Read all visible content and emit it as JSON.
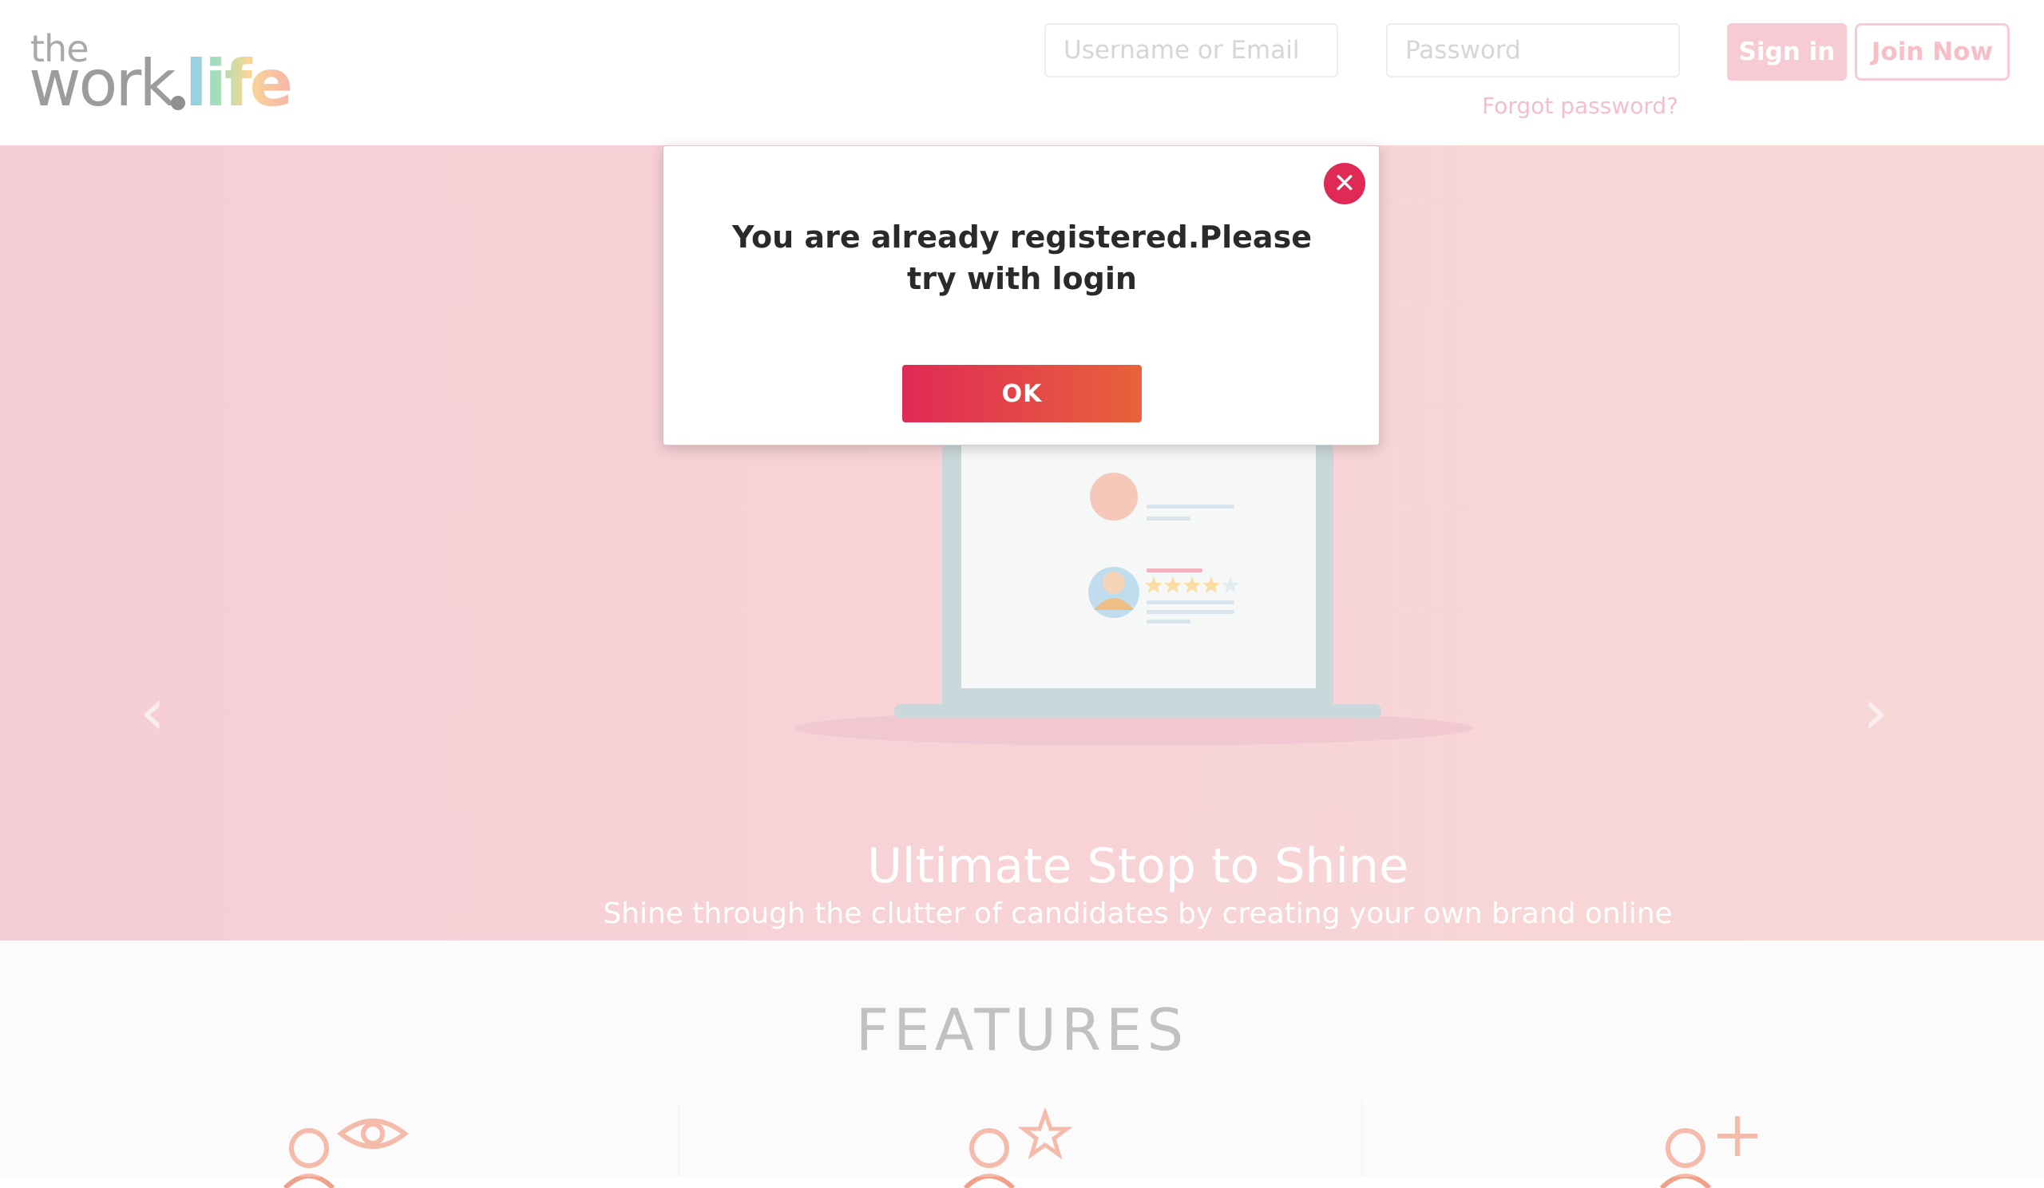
{
  "header": {
    "logo_top": "the",
    "logo_left": "work",
    "logo_right": "life",
    "username_placeholder": "Username or Email",
    "password_placeholder": "Password",
    "forgot_label": "Forgot password?",
    "signin_label": "Sign in",
    "join_label": "Join Now"
  },
  "hero": {
    "title": "Ultimate Stop to Shine",
    "subtitle": "Shine through the clutter of candidates by creating your own brand online through reviews and feedbacks at thework.life",
    "slides_count": 3,
    "active_slide": 1
  },
  "features": {
    "title": "FEATURES",
    "icons": [
      "user-eye-icon",
      "user-star-icon",
      "user-plus-icon"
    ]
  },
  "modal": {
    "message": "You are already registered.Please try with login",
    "ok_label": "OK"
  },
  "colors": {
    "accent": "#df2a55",
    "accent_end": "#e8623b",
    "hero_bg": "#f3bcc7",
    "soft_pink": "#f4b8c2"
  }
}
